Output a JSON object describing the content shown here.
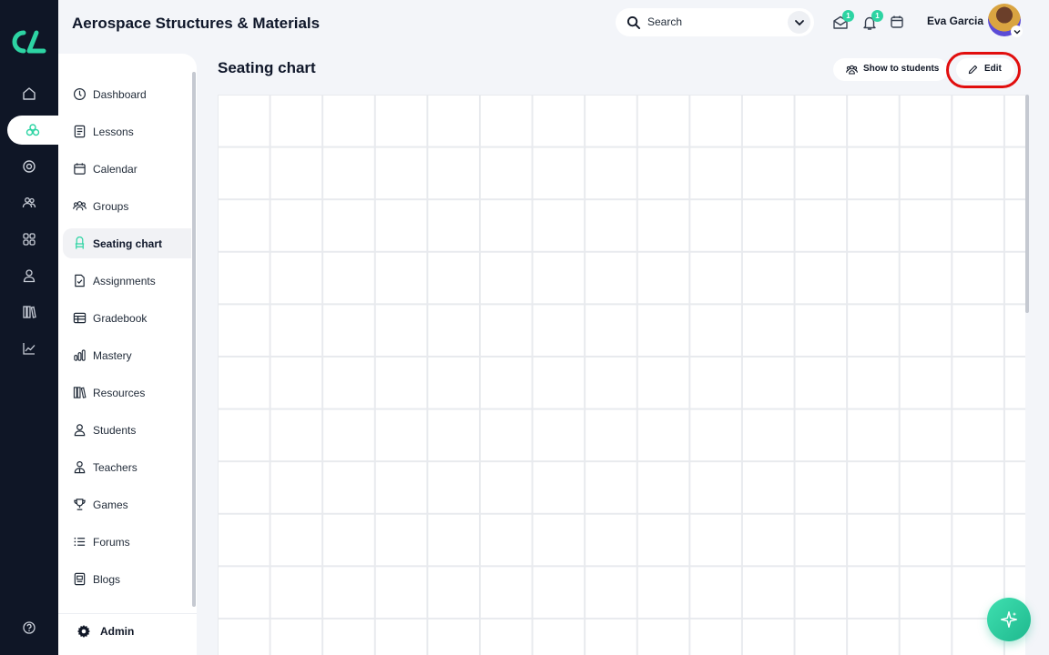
{
  "header": {
    "course_title": "Aerospace Structures & Materials",
    "search_placeholder": "Search",
    "messages_badge": "1",
    "notifications_badge": "1",
    "user_name": "Eva Garcia"
  },
  "rail": {
    "icons": [
      "home-icon",
      "groups-hex-icon",
      "target-icon",
      "people-icon",
      "apps-grid-icon",
      "person-icon",
      "library-icon",
      "chart-icon",
      "help-icon"
    ],
    "active_index": 1
  },
  "sidebar": {
    "items": [
      {
        "label": "Dashboard",
        "icon": "dashboard-icon"
      },
      {
        "label": "Lessons",
        "icon": "lessons-icon"
      },
      {
        "label": "Calendar",
        "icon": "calendar-icon"
      },
      {
        "label": "Groups",
        "icon": "groups-icon"
      },
      {
        "label": "Seating chart",
        "icon": "seating-chart-icon"
      },
      {
        "label": "Assignments",
        "icon": "assignments-icon"
      },
      {
        "label": "Gradebook",
        "icon": "gradebook-icon"
      },
      {
        "label": "Mastery",
        "icon": "mastery-icon"
      },
      {
        "label": "Resources",
        "icon": "resources-icon"
      },
      {
        "label": "Students",
        "icon": "students-icon"
      },
      {
        "label": "Teachers",
        "icon": "teachers-icon"
      },
      {
        "label": "Games",
        "icon": "games-icon"
      },
      {
        "label": "Forums",
        "icon": "forums-icon"
      },
      {
        "label": "Blogs",
        "icon": "blogs-icon"
      }
    ],
    "active_index": 4,
    "admin_label": "Admin"
  },
  "main": {
    "title": "Seating chart",
    "show_to_students_label": "Show to students",
    "edit_label": "Edit"
  },
  "colors": {
    "accent": "#2dd4a3",
    "rail_bg": "#0f1626",
    "highlight_ring": "#e10e0e"
  }
}
